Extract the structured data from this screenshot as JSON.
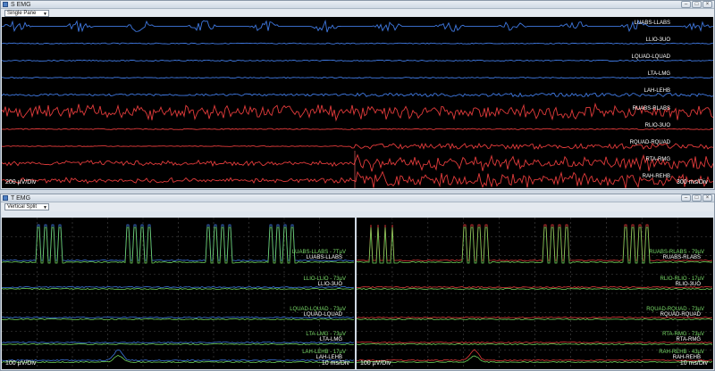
{
  "s_window": {
    "title": "S EMG",
    "mode": "Single Pane",
    "scale_left": "200 µV/Div",
    "scale_right": "300 ms/Div",
    "channels": [
      {
        "label": "LUABS-LLABS",
        "color": "#3f78e0",
        "icon": "trace-blue"
      },
      {
        "label": "LLIO-3UO",
        "color": "#3f78e0"
      },
      {
        "label": "LQUAD-LQUAD",
        "color": "#3f78e0"
      },
      {
        "label": "LTA-LMG",
        "color": "#3f78e0"
      },
      {
        "label": "LAH-LEHB",
        "color": "#3f78e0"
      },
      {
        "label": "RUABS-RLABS",
        "color": "#e23b3b"
      },
      {
        "label": "RLIO-3UO",
        "color": "#e23b3b"
      },
      {
        "label": "RQUAD-RQUAD",
        "color": "#e23b3b"
      },
      {
        "label": "RTA-RMG",
        "color": "#e23b3b"
      },
      {
        "label": "RAH-REHB",
        "color": "#e23b3b"
      }
    ]
  },
  "t_window": {
    "title": "T EMG",
    "mode": "Vertical Split",
    "left_pane": {
      "scale_left": "100 µV/Div",
      "scale_right": "10 ms/Div",
      "labels": [
        {
          "text": "LUABS-LLABS - 7TµV",
          "sub": "LUABS-LLABS"
        },
        {
          "text": "LLIO-LLIO - 73µV",
          "sub": "LLIO-3UO"
        },
        {
          "text": "LQUAD-LQUAD - 73µV",
          "sub": "LQUAD-LQUAD"
        },
        {
          "text": "LTA-LMG - 73µV",
          "sub": "LTA-LMG"
        },
        {
          "text": "LAH-LEHB - 17µV",
          "sub": "LAH-LEHB"
        }
      ]
    },
    "right_pane": {
      "scale_left": "100 µV/Div",
      "scale_right": "10 ms/Div",
      "labels": [
        {
          "text": "RUABS-RLABS - 79µV",
          "sub": "RUABS-RLABS"
        },
        {
          "text": "RLIO-RLIO - 17µV",
          "sub": "RLIO-3UO"
        },
        {
          "text": "RQUAD-RQUAD - 73µV",
          "sub": "RQUAD-RQUAD"
        },
        {
          "text": "RTA-RMG - 73µV",
          "sub": "RTA-RMG"
        },
        {
          "text": "RAH-REHB - 43µV",
          "sub": "RAH-REHB"
        }
      ]
    }
  },
  "window_buttons": {
    "minimize": "–",
    "maximize": "□",
    "close": "×"
  },
  "colors": {
    "blue_trace": "#3f78e0",
    "red_trace": "#e23b3b",
    "green_trace": "#6fd35a",
    "grid": "#5a5a5a"
  }
}
